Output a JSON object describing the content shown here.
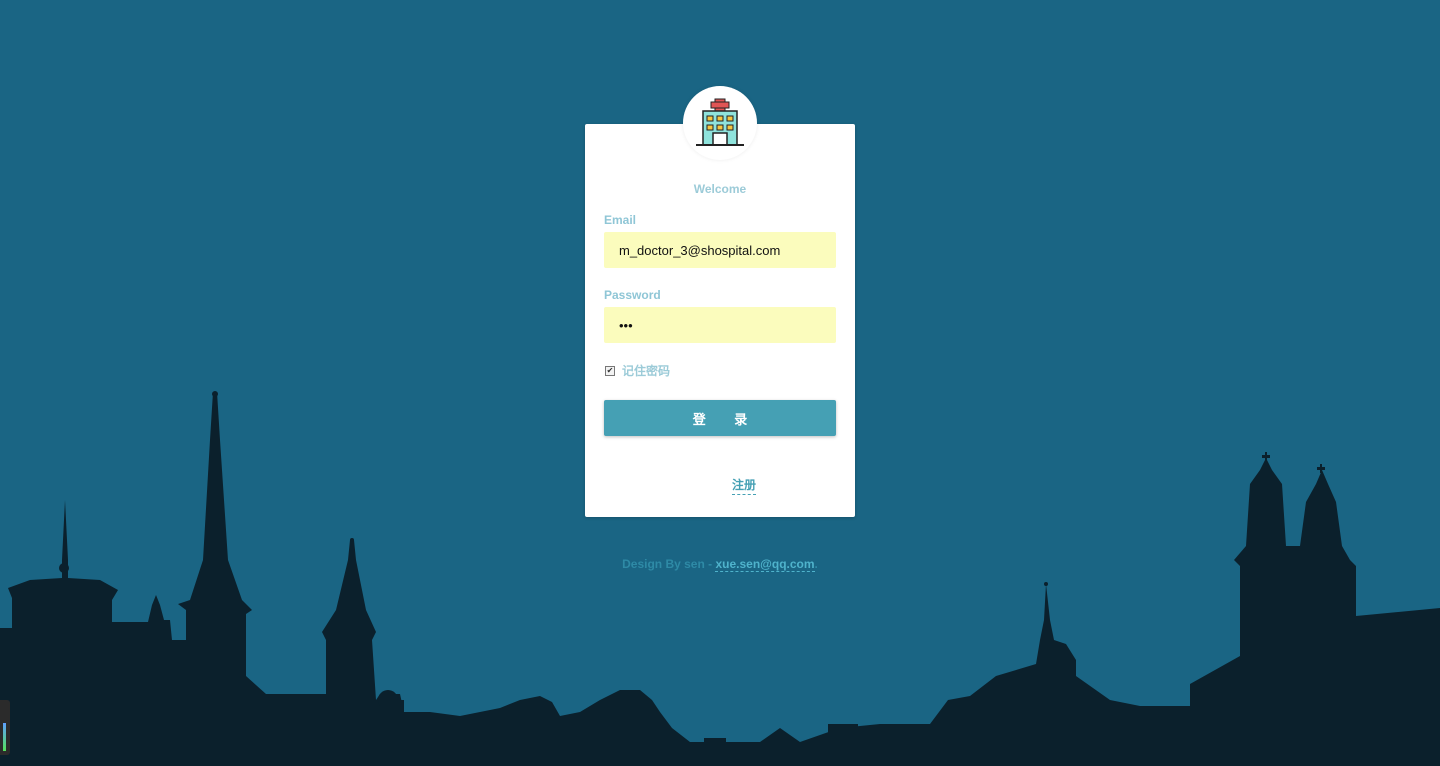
{
  "login": {
    "welcome": "Welcome",
    "email_label": "Email",
    "email_value": "m_doctor_3@shospital.com",
    "password_label": "Password",
    "password_value": "123",
    "remember_label": "记住密码",
    "remember_checked": true,
    "login_button": "登 录",
    "register_link": "注册"
  },
  "footer": {
    "prefix": "Design By sen -",
    "email": "xue.sen@qq.com",
    "suffix": "."
  },
  "logo": {
    "icon": "hospital-icon"
  },
  "colors": {
    "background": "#1a6584",
    "skyline": "#0b202c",
    "accent": "#45a0b4",
    "input_bg": "#fbfcbd"
  }
}
